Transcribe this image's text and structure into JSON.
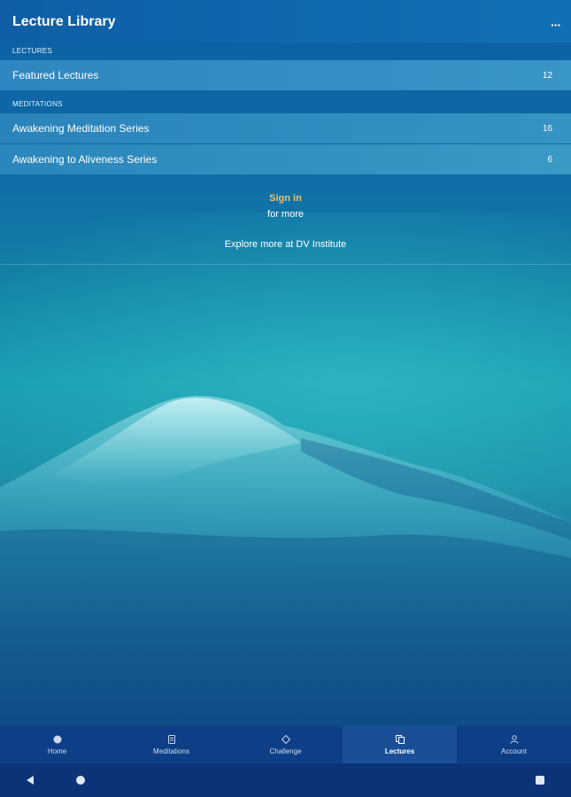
{
  "header": {
    "title": "Lecture Library",
    "menu_icon": "overflow-menu-icon"
  },
  "sections": {
    "lectures": {
      "label": "LECTURES",
      "items": [
        {
          "label": "Featured Lectures",
          "count": "12"
        }
      ]
    },
    "meditations": {
      "label": "MEDITATIONS",
      "items": [
        {
          "label": "Awakening Meditation Series",
          "count": "16"
        },
        {
          "label": "Awakening to Aliveness Series",
          "count": "6"
        }
      ]
    }
  },
  "signin": {
    "link": "Sign in",
    "suffix": "for more",
    "explore": "Explore more at DV Institute"
  },
  "tabs": [
    {
      "label": "Home",
      "icon": "home-icon"
    },
    {
      "label": "Meditations",
      "icon": "meditations-icon"
    },
    {
      "label": "Challenge",
      "icon": "challenge-icon"
    },
    {
      "label": "Lectures",
      "icon": "lectures-icon",
      "active": true
    },
    {
      "label": "Account",
      "icon": "account-icon"
    }
  ],
  "colors": {
    "accent": "#f2c072",
    "tabbar": "#0e3f86",
    "row_highlight": "#3a95c8"
  }
}
